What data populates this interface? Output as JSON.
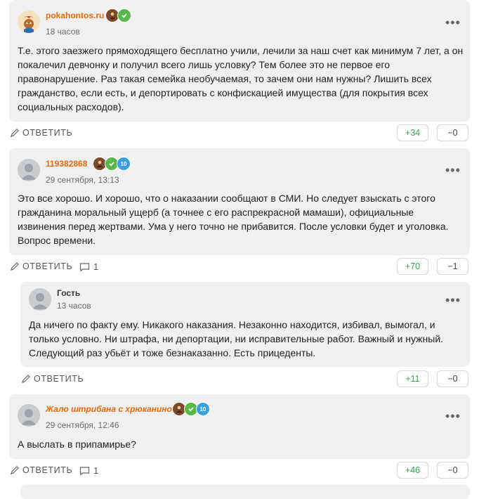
{
  "ui": {
    "reply_label": "ОТВЕТИТЬ",
    "more_icon": "more-dots-icon",
    "pencil_icon": "pencil-icon",
    "comment_icon": "comment-bubble-icon",
    "accent_author": "#e8680c",
    "up_color": "#3a9f4c"
  },
  "comments": [
    {
      "author": "pokahontos.ru",
      "time": "18 часов",
      "badges": [
        "person",
        "check"
      ],
      "text": "Т.е. этого заезжего прямоходящего бесплатно учили, лечили за наш счет как минимум 7 лет, а он покалечил девчонку и получил всего лишь условку? Тем более это не первое его правонарушение. Раз такая семейка необучаемая, то зачем они нам нужны? Лишить всех гражданство, если есть, и депортировать с конфискацией имущества (для покрытия всех социальных расходов).",
      "up": "+34",
      "down": "−0"
    },
    {
      "author": "119382868",
      "time": "29 сентября, 13:13",
      "badges": [
        "person",
        "check",
        "10"
      ],
      "text": "Это все хорошо. И хорошо, что о наказании сообщают в СМИ. Но следует взыскать с этого гражданина моральный ущерб (а точнее с его распрекрасной мамаши), официальные извинения перед жертвами. Ума у него точно не прибавится. После условки будет и уголовка. Вопрос времени.",
      "replies": "1",
      "up": "+70",
      "down": "−1"
    },
    {
      "author": "Гость",
      "time": "13 часов",
      "text": "Да ничего по факту ему. Никакого наказания. Незаконно находится, избивал, вымогал, и только условно. Ни штрафа, ни депортации, ни исправительные работ. Важный и нужный. Следующий раз убьёт и тоже безнаказанно. Есть прицеденты.",
      "up": "+11",
      "down": "−0"
    },
    {
      "author": "Жало штрибана с хрюканиной",
      "time": "29 сентября, 12:46",
      "badges": [
        "person",
        "check",
        "10"
      ],
      "text": "А выслать в припамирье?",
      "replies": "1",
      "up": "+46",
      "down": "−0"
    }
  ]
}
